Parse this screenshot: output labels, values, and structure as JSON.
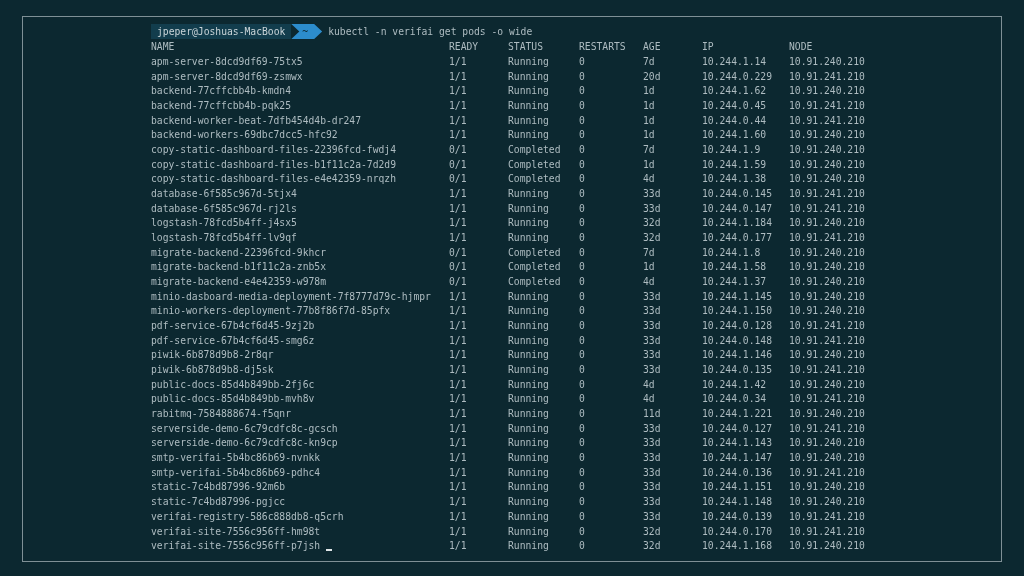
{
  "prompt": {
    "user_host": "jpeper@Joshuas-MacBook",
    "cwd": "~",
    "command": "kubectl -n verifai get pods -o wide"
  },
  "table": {
    "columns": [
      "NAME",
      "READY",
      "STATUS",
      "RESTARTS",
      "AGE",
      "IP",
      "NODE"
    ],
    "rows": [
      [
        "apm-server-8dcd9df69-75tx5",
        "1/1",
        "Running",
        "0",
        "7d",
        "10.244.1.14",
        "10.91.240.210"
      ],
      [
        "apm-server-8dcd9df69-zsmwx",
        "1/1",
        "Running",
        "0",
        "20d",
        "10.244.0.229",
        "10.91.241.210"
      ],
      [
        "backend-77cffcbb4b-kmdn4",
        "1/1",
        "Running",
        "0",
        "1d",
        "10.244.1.62",
        "10.91.240.210"
      ],
      [
        "backend-77cffcbb4b-pqk25",
        "1/1",
        "Running",
        "0",
        "1d",
        "10.244.0.45",
        "10.91.241.210"
      ],
      [
        "backend-worker-beat-7dfb454d4b-dr247",
        "1/1",
        "Running",
        "0",
        "1d",
        "10.244.0.44",
        "10.91.241.210"
      ],
      [
        "backend-workers-69dbc7dcc5-hfc92",
        "1/1",
        "Running",
        "0",
        "1d",
        "10.244.1.60",
        "10.91.240.210"
      ],
      [
        "copy-static-dashboard-files-22396fcd-fwdj4",
        "0/1",
        "Completed",
        "0",
        "7d",
        "10.244.1.9",
        "10.91.240.210"
      ],
      [
        "copy-static-dashboard-files-b1f11c2a-7d2d9",
        "0/1",
        "Completed",
        "0",
        "1d",
        "10.244.1.59",
        "10.91.240.210"
      ],
      [
        "copy-static-dashboard-files-e4e42359-nrqzh",
        "0/1",
        "Completed",
        "0",
        "4d",
        "10.244.1.38",
        "10.91.240.210"
      ],
      [
        "database-6f585c967d-5tjx4",
        "1/1",
        "Running",
        "0",
        "33d",
        "10.244.0.145",
        "10.91.241.210"
      ],
      [
        "database-6f585c967d-rj2ls",
        "1/1",
        "Running",
        "0",
        "33d",
        "10.244.0.147",
        "10.91.241.210"
      ],
      [
        "logstash-78fcd5b4ff-j4sx5",
        "1/1",
        "Running",
        "0",
        "32d",
        "10.244.1.184",
        "10.91.240.210"
      ],
      [
        "logstash-78fcd5b4ff-lv9qf",
        "1/1",
        "Running",
        "0",
        "32d",
        "10.244.0.177",
        "10.91.241.210"
      ],
      [
        "migrate-backend-22396fcd-9khcr",
        "0/1",
        "Completed",
        "0",
        "7d",
        "10.244.1.8",
        "10.91.240.210"
      ],
      [
        "migrate-backend-b1f11c2a-znb5x",
        "0/1",
        "Completed",
        "0",
        "1d",
        "10.244.1.58",
        "10.91.240.210"
      ],
      [
        "migrate-backend-e4e42359-w978m",
        "0/1",
        "Completed",
        "0",
        "4d",
        "10.244.1.37",
        "10.91.240.210"
      ],
      [
        "minio-dasboard-media-deployment-7f8777d79c-hjmpr",
        "1/1",
        "Running",
        "0",
        "33d",
        "10.244.1.145",
        "10.91.240.210"
      ],
      [
        "minio-workers-deployment-77b8f86f7d-85pfx",
        "1/1",
        "Running",
        "0",
        "33d",
        "10.244.1.150",
        "10.91.240.210"
      ],
      [
        "pdf-service-67b4cf6d45-9zj2b",
        "1/1",
        "Running",
        "0",
        "33d",
        "10.244.0.128",
        "10.91.241.210"
      ],
      [
        "pdf-service-67b4cf6d45-smg6z",
        "1/1",
        "Running",
        "0",
        "33d",
        "10.244.0.148",
        "10.91.241.210"
      ],
      [
        "piwik-6b878d9b8-2r8qr",
        "1/1",
        "Running",
        "0",
        "33d",
        "10.244.1.146",
        "10.91.240.210"
      ],
      [
        "piwik-6b878d9b8-dj5sk",
        "1/1",
        "Running",
        "0",
        "33d",
        "10.244.0.135",
        "10.91.241.210"
      ],
      [
        "public-docs-85d4b849bb-2fj6c",
        "1/1",
        "Running",
        "0",
        "4d",
        "10.244.1.42",
        "10.91.240.210"
      ],
      [
        "public-docs-85d4b849bb-mvh8v",
        "1/1",
        "Running",
        "0",
        "4d",
        "10.244.0.34",
        "10.91.241.210"
      ],
      [
        "rabitmq-7584888674-f5qnr",
        "1/1",
        "Running",
        "0",
        "11d",
        "10.244.1.221",
        "10.91.240.210"
      ],
      [
        "serverside-demo-6c79cdfc8c-gcsch",
        "1/1",
        "Running",
        "0",
        "33d",
        "10.244.0.127",
        "10.91.241.210"
      ],
      [
        "serverside-demo-6c79cdfc8c-kn9cp",
        "1/1",
        "Running",
        "0",
        "33d",
        "10.244.1.143",
        "10.91.240.210"
      ],
      [
        "smtp-verifai-5b4bc86b69-nvnkk",
        "1/1",
        "Running",
        "0",
        "33d",
        "10.244.1.147",
        "10.91.240.210"
      ],
      [
        "smtp-verifai-5b4bc86b69-pdhc4",
        "1/1",
        "Running",
        "0",
        "33d",
        "10.244.0.136",
        "10.91.241.210"
      ],
      [
        "static-7c4bd87996-92m6b",
        "1/1",
        "Running",
        "0",
        "33d",
        "10.244.1.151",
        "10.91.240.210"
      ],
      [
        "static-7c4bd87996-pgjcc",
        "1/1",
        "Running",
        "0",
        "33d",
        "10.244.1.148",
        "10.91.240.210"
      ],
      [
        "verifai-registry-586c888db8-q5crh",
        "1/1",
        "Running",
        "0",
        "33d",
        "10.244.0.139",
        "10.91.241.210"
      ],
      [
        "verifai-site-7556c956ff-hm98t",
        "1/1",
        "Running",
        "0",
        "32d",
        "10.244.0.170",
        "10.91.241.210"
      ],
      [
        "verifai-site-7556c956ff-p7jsh",
        "1/1",
        "Running",
        "0",
        "32d",
        "10.244.1.168",
        "10.91.240.210"
      ]
    ]
  }
}
